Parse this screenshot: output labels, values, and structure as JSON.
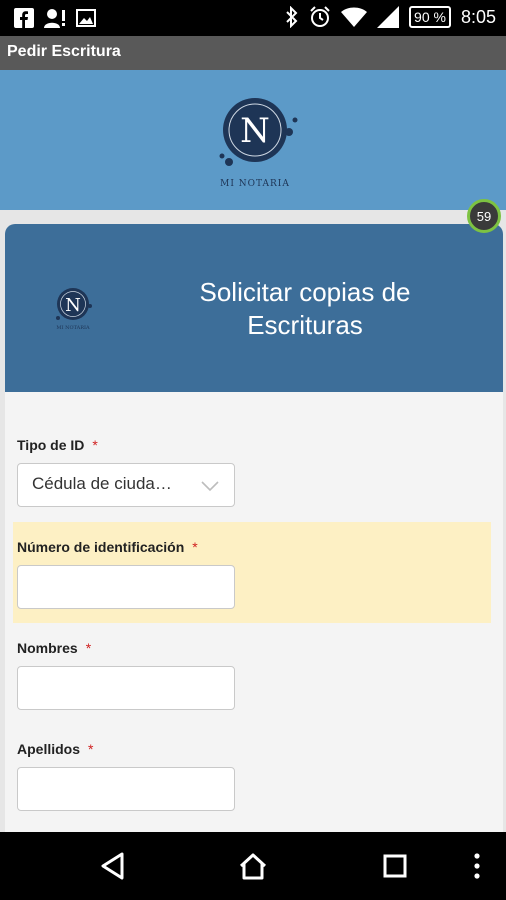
{
  "status_bar": {
    "battery": "90 %",
    "time": "8:05"
  },
  "app_bar": {
    "title": "Pedir Escritura"
  },
  "banner": {
    "logo_letter": "N",
    "logo_text": "MI NOTARIA"
  },
  "counter_badge": "59",
  "card": {
    "logo_letter": "N",
    "logo_text": "MI NOTARIA",
    "title_line1": "Solicitar copias de",
    "title_line2": "Escrituras"
  },
  "form": {
    "required_mark": "*",
    "tipo_id": {
      "label": "Tipo de ID",
      "value": "Cédula de ciuda…"
    },
    "numero_id": {
      "label": "Número de identificación",
      "value": ""
    },
    "nombres": {
      "label": "Nombres",
      "value": ""
    },
    "apellidos": {
      "label": "Apellidos",
      "value": ""
    }
  },
  "colors": {
    "banner": "#5c9ac8",
    "card_header": "#3d6e99",
    "highlight": "#fdf0c4",
    "required": "#d02020",
    "badge_ring": "#7dc242"
  }
}
